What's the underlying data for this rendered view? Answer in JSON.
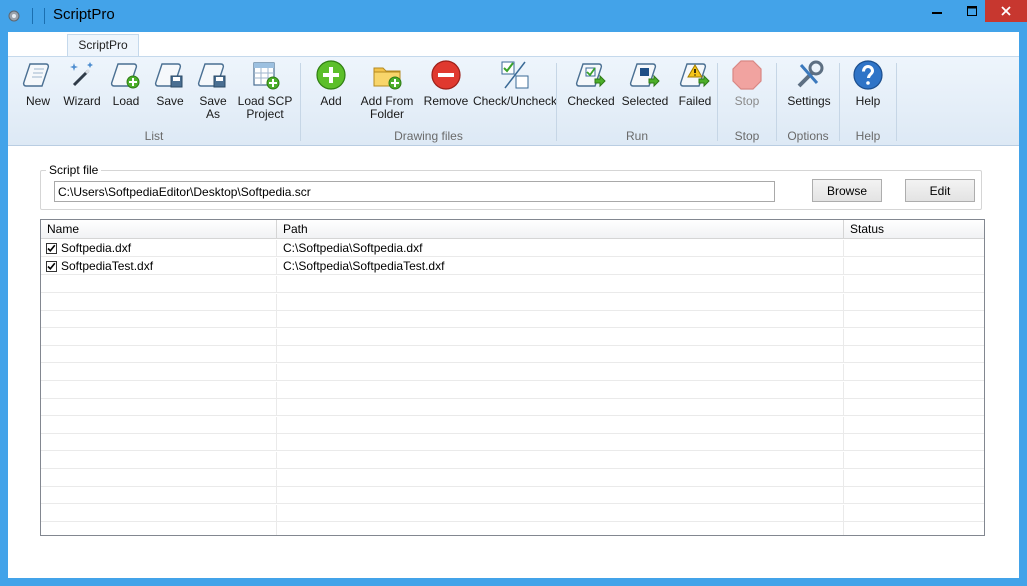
{
  "window": {
    "title": "ScriptPro",
    "accent": "#43a3e9",
    "close_color": "#c7372f"
  },
  "ribbon": {
    "tab": "ScriptPro",
    "groups": {
      "list": {
        "label": "List",
        "new": "New",
        "wizard": "Wizard",
        "load": "Load",
        "save": "Save",
        "save_as_1": "Save",
        "save_as_2": "As",
        "load_scp_1": "Load SCP",
        "load_scp_2": "Project"
      },
      "drawing": {
        "label": "Drawing files",
        "add": "Add",
        "add_folder_1": "Add From",
        "add_folder_2": "Folder",
        "remove": "Remove",
        "check": "Check/Uncheck"
      },
      "run": {
        "label": "Run",
        "checked": "Checked",
        "selected": "Selected",
        "failed": "Failed"
      },
      "stop": {
        "label": "Stop",
        "stop": "Stop"
      },
      "options": {
        "label": "Options",
        "settings": "Settings"
      },
      "help": {
        "label": "Help",
        "help": "Help"
      }
    }
  },
  "script_file": {
    "label": "Script file",
    "value": "C:\\Users\\SoftpediaEditor\\Desktop\\Softpedia.scr",
    "browse": "Browse",
    "edit": "Edit"
  },
  "files": {
    "columns": [
      "Name",
      "Path",
      "Status"
    ],
    "rows": [
      {
        "name": "Softpedia.dxf",
        "path": "C:\\Softpedia\\Softpedia.dxf",
        "status": ""
      },
      {
        "name": "SoftpediaTest.dxf",
        "path": "C:\\Softpedia\\SoftpediaTest.dxf",
        "status": ""
      }
    ]
  }
}
